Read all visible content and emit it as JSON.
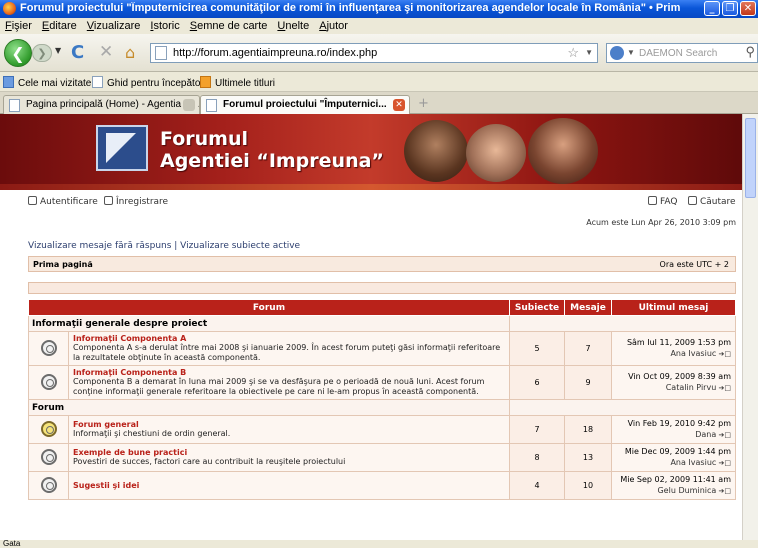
{
  "window": {
    "title": "Forumul proiectului \"Împuternicirea comunităţilor de romi în influenţarea şi monitorizarea agendelor locale în România\" • Prima pagină - Mozilla Fi..."
  },
  "menu": [
    "Fişier",
    "Editare",
    "Vizualizare",
    "Istoric",
    "Semne de carte",
    "Unelte",
    "Ajutor"
  ],
  "nav": {
    "url": "http://forum.agentiaimpreuna.ro/index.php",
    "search_placeholder": "DAEMON Search"
  },
  "bookmarks": [
    "Cele mai vizitate",
    "Ghid pentru începători",
    "Ultimele titluri"
  ],
  "tabs": [
    {
      "label": "Pagina principală (Home) - Agentia de ..."
    },
    {
      "label": "Forumul proiectului \"Împuternici..."
    }
  ],
  "banner": {
    "line1": "Forumul",
    "line2": "Agentiei “Impreuna”"
  },
  "top_links": {
    "login": "Autentificare",
    "register": "Înregistrare",
    "faq": "FAQ",
    "search": "Căutare"
  },
  "timestamp": "Acum este Lun Apr 26, 2010 3:09 pm",
  "actions": "Vizualizare mesaje fără răspuns | Vizualizare subiecte active",
  "breadcrumb": {
    "home": "Prima pagină",
    "tz": "Ora este UTC + 2"
  },
  "table": {
    "headers": {
      "forum": "Forum",
      "topics": "Subiecte",
      "posts": "Mesaje",
      "last": "Ultimul mesaj"
    },
    "categories": [
      {
        "name": "Informaţii generale despre proiect",
        "forums": [
          {
            "title": "Informaţii Componenta A",
            "desc": "Componenta A s-a derulat între mai 2008 şi ianuarie 2009. În acest forum puteţi găsi informaţii referitoare la rezultatele obţinute în această componentă.",
            "topics": "5",
            "posts": "7",
            "last_date": "Sâm Iul 11, 2009 1:53 pm",
            "last_user": "Ana Ivasiuc",
            "new": false
          },
          {
            "title": "Informaţii Componenta B",
            "desc": "Componenta B a demarat în luna mai 2009 şi se va desfăşura pe o perioadă de nouă luni. Acest forum conţine informaţii generale referitoare la obiectivele pe care ni le-am propus în această componentă.",
            "topics": "6",
            "posts": "9",
            "last_date": "Vin Oct 09, 2009 8:39 am",
            "last_user": "Catalin Pirvu",
            "new": false
          }
        ]
      },
      {
        "name": "Forum",
        "forums": [
          {
            "title": "Forum general",
            "desc": "Informaţii şi chestiuni de ordin general.",
            "topics": "7",
            "posts": "18",
            "last_date": "Vin Feb 19, 2010 9:42 pm",
            "last_user": "Dana",
            "new": true
          },
          {
            "title": "Exemple de bune practici",
            "desc": "Povestiri de succes, factori care au contribuit la reuşitele proiectului",
            "topics": "8",
            "posts": "13",
            "last_date": "Mie Dec 09, 2009 1:44 pm",
            "last_user": "Ana Ivasiuc",
            "new": false
          },
          {
            "title": "Sugestii şi idei",
            "desc": "",
            "topics": "4",
            "posts": "10",
            "last_date": "Mie Sep 02, 2009 11:41 am",
            "last_user": "Gelu Duminica",
            "new": false
          }
        ]
      }
    ]
  },
  "status": "Gata"
}
